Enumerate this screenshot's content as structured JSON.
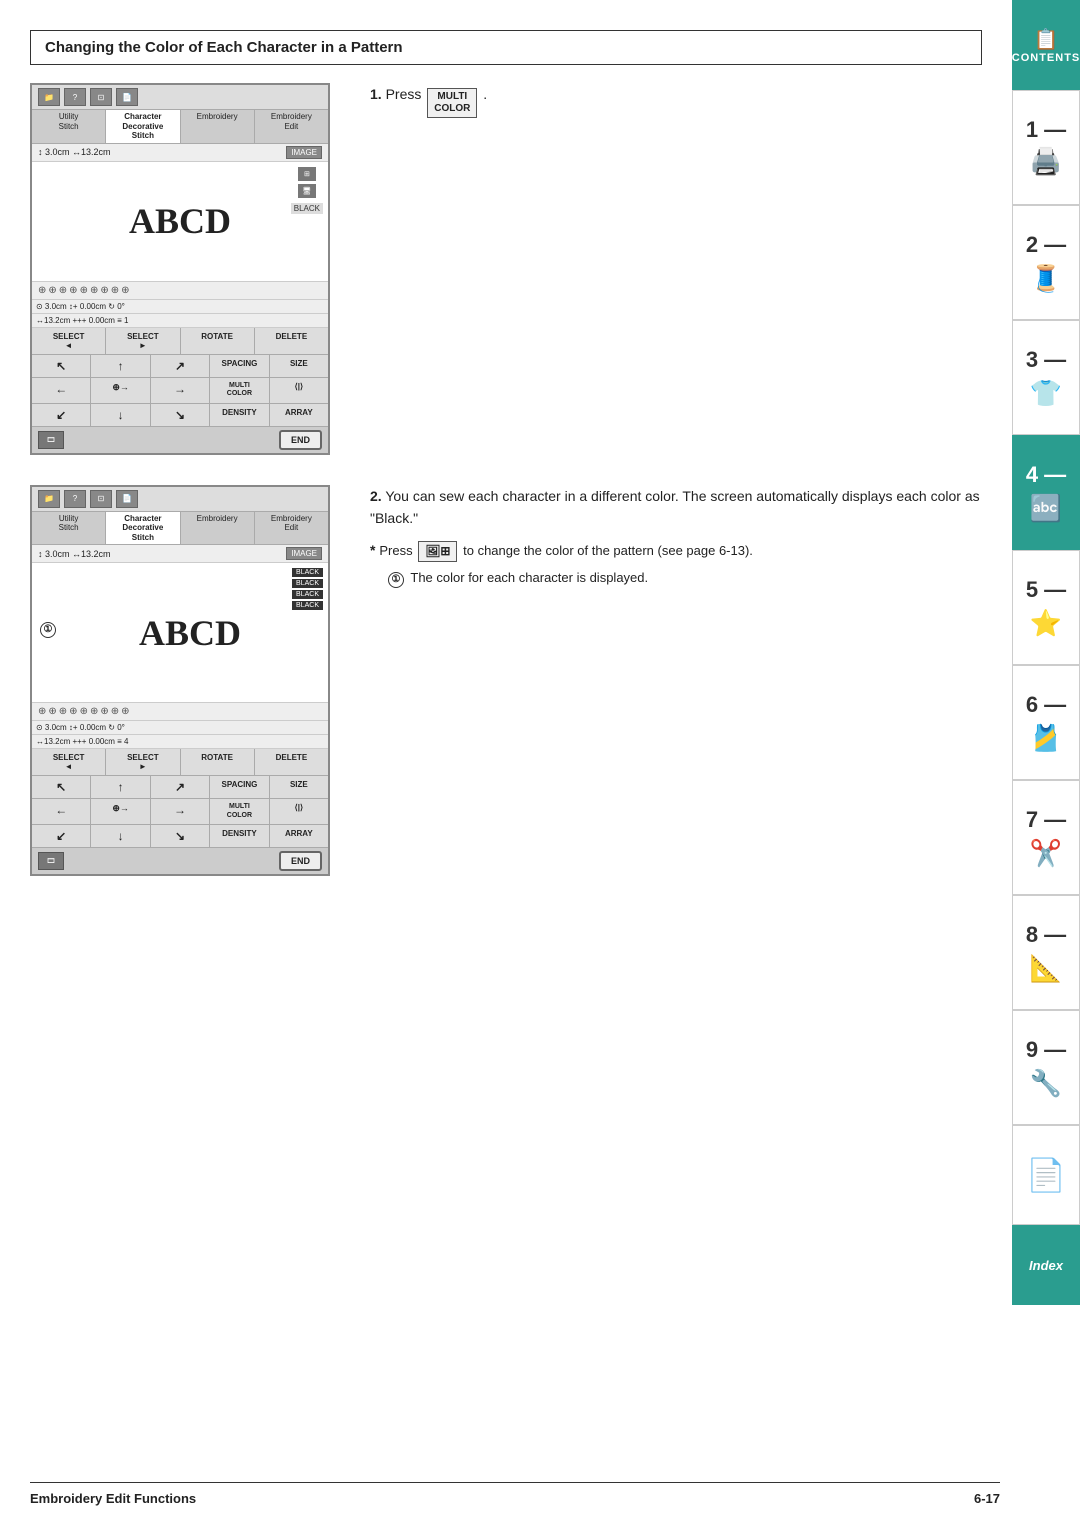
{
  "page": {
    "title": "Changing the Color of Each Character in a Pattern",
    "footer": {
      "left": "Embroidery Edit Functions",
      "right": "6-17"
    }
  },
  "sidebar": {
    "tabs": [
      {
        "id": "contents",
        "label": "CONTENTS",
        "type": "teal",
        "number": "",
        "icon": "📋"
      },
      {
        "id": "1",
        "label": "",
        "number": "1",
        "dash": "—",
        "type": "white",
        "icon": "🖨"
      },
      {
        "id": "2",
        "label": "",
        "number": "2",
        "dash": "—",
        "type": "white",
        "icon": "🧵"
      },
      {
        "id": "3",
        "label": "",
        "number": "3",
        "dash": "—",
        "type": "white",
        "icon": "👕"
      },
      {
        "id": "4",
        "label": "",
        "number": "4",
        "dash": "—",
        "type": "teal",
        "icon": "🔤"
      },
      {
        "id": "5",
        "label": "",
        "number": "5",
        "dash": "—",
        "type": "white",
        "icon": "⭐"
      },
      {
        "id": "6",
        "label": "",
        "number": "6",
        "dash": "—",
        "type": "white",
        "icon": "🎽"
      },
      {
        "id": "7",
        "label": "",
        "number": "7",
        "dash": "—",
        "type": "white",
        "icon": "✂️"
      },
      {
        "id": "8",
        "label": "",
        "number": "8",
        "dash": "—",
        "type": "white",
        "icon": "📐"
      },
      {
        "id": "9",
        "label": "",
        "number": "9",
        "dash": "—",
        "type": "white",
        "icon": "🔧"
      },
      {
        "id": "note",
        "label": "",
        "number": "",
        "type": "white",
        "icon": "📄"
      },
      {
        "id": "index",
        "label": "Index",
        "type": "teal",
        "icon": "📑"
      }
    ]
  },
  "screen1": {
    "top_icons": [
      "📁",
      "❓",
      "🔲",
      "📄"
    ],
    "tabs": [
      {
        "label": "Utility\nStitch",
        "active": false
      },
      {
        "label": "Character\nDecorative\nStitch",
        "active": true
      },
      {
        "label": "Embroidery",
        "active": false
      },
      {
        "label": "Embroidery\nEdit",
        "active": false
      }
    ],
    "measure": "↕ 3.0cm ↔13.2cm",
    "image_btn": "IMAGE",
    "abcd_text": "ABCD",
    "black_label": "BLACK",
    "params": "⊙ 3.0cm ↕+ 0.00cm ↻ 0°\n↔13.2cm +++ 0.00cm ≡ 1",
    "buttons": [
      [
        "SELECT ◄",
        "SELECT ►",
        "ROTATE",
        "DELETE"
      ],
      [
        "↖",
        "↑",
        "↗",
        "SPACING",
        "SIZE"
      ],
      [
        "←",
        "⊕→",
        "→",
        "MULTI\nCOLOR",
        "⟨|⟩"
      ],
      [
        "↙",
        "↓",
        "↘",
        "DENSITY",
        "ARRAY"
      ],
      [
        "END"
      ]
    ],
    "hash_count": 9
  },
  "screen2": {
    "top_icons": [
      "📁",
      "❓",
      "🔲",
      "📄"
    ],
    "tabs": [
      {
        "label": "Utility\nStitch",
        "active": false
      },
      {
        "label": "Character\nDecorative\nStitch",
        "active": true
      },
      {
        "label": "Embroidery",
        "active": false
      },
      {
        "label": "Embroidery\nEdit",
        "active": false
      }
    ],
    "measure": "↕ 3.0cm ↔13.2cm",
    "image_btn": "IMAGE",
    "abcd_text": "ABCD",
    "color_labels": [
      "BLACK",
      "BLACK",
      "BLACK",
      "BLACK"
    ],
    "circle_number": "①",
    "params": "⊙ 3.0cm ↕+ 0.00cm ↻ 0°\n↔13.2cm +++ 0.00cm ≡ 4",
    "buttons": [
      [
        "SELECT ◄",
        "SELECT ►",
        "ROTATE",
        "DELETE"
      ],
      [
        "↖",
        "↑",
        "↗",
        "SPACING",
        "SIZE"
      ],
      [
        "←",
        "⊕→",
        "→",
        "MULTI\nCOLOR",
        "⟨|⟩"
      ],
      [
        "↙",
        "↓",
        "↘",
        "DENSITY",
        "ARRAY"
      ],
      [
        "END"
      ]
    ],
    "hash_count": 9
  },
  "steps": {
    "step1": {
      "number": "1.",
      "text": "Press",
      "key_label": "MULTI\nCOLOR",
      "suffix": "."
    },
    "step2": {
      "number": "2.",
      "text": "You can sew each character in a different color. The screen automatically displays each color as \"Black.\""
    },
    "note": {
      "star": "*",
      "text": "Press",
      "key_icon": "🖼",
      "suffix": "to change the color of the pattern (see page 6-13).",
      "sub": {
        "circle": "①",
        "text": "The color for each character is displayed."
      }
    }
  }
}
